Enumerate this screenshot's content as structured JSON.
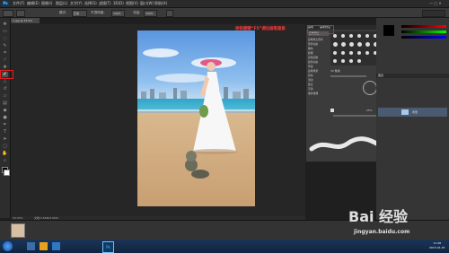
{
  "menubar": {
    "app_icon": "Ps",
    "items": [
      "文件(F)",
      "编辑(E)",
      "图像(I)",
      "图层(L)",
      "文字(Y)",
      "选择(S)",
      "滤镜(T)",
      "3D(D)",
      "视图(V)",
      "窗口(W)",
      "帮助(H)"
    ]
  },
  "options_bar": {
    "mode_label": "模式:",
    "mode_value": "正常",
    "opacity_label": "不透明度:",
    "opacity_value": "100%",
    "flow_label": "流量:",
    "flow_value": "100%"
  },
  "document_tab": {
    "title": "1.jpg @ 33.3%(RGB/8)"
  },
  "context_menu": {
    "items": [
      "■ 画笔工具  B",
      "■ 铅笔工具  B"
    ]
  },
  "brush_panel": {
    "tab_brush": "画笔",
    "tab_presets": "画笔预设",
    "button": "画笔预设",
    "items": [
      "画笔笔尖形状",
      "形状动态",
      "散布",
      "纹理",
      "双重画笔",
      "颜色动态",
      "传递",
      "画笔笔势",
      "杂色",
      "湿边",
      "建立",
      "平滑",
      "保护纹理"
    ],
    "size_value": "30 像素",
    "spacing_value": "25%"
  },
  "annotation": {
    "text": "按快捷键“F5”调出画笔面板"
  },
  "layers_panel": {
    "layer_name": "背景",
    "tab": "图层"
  },
  "status": {
    "zoom": "33.33%",
    "doc": "文档:3.65M/3.65M"
  },
  "taskbar": {
    "time": "11:28",
    "date": "2015-01-25"
  },
  "watermark": {
    "logo": "Bai 经验",
    "url": "jingyan.baidu.com"
  },
  "colors": {
    "accent_red": "#e02020",
    "ui_bg": "#353535"
  }
}
